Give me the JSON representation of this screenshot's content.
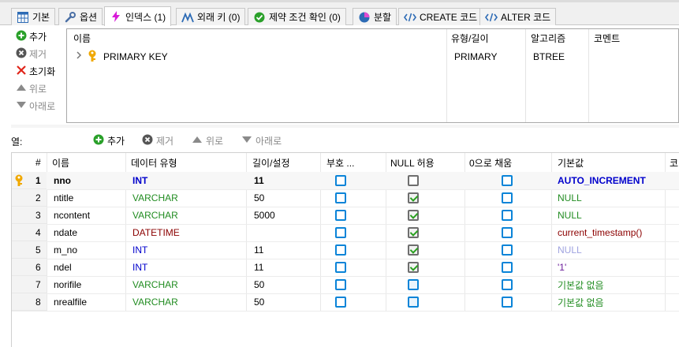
{
  "tabs": [
    {
      "label": "기본",
      "icon": "table-icon"
    },
    {
      "label": "옵션",
      "icon": "wrench-icon"
    },
    {
      "label": "인덱스 (1)",
      "icon": "lightning-icon"
    },
    {
      "label": "외래 키 (0)",
      "icon": "foreign-key-icon"
    },
    {
      "label": "제약 조건 확인 (0)",
      "icon": "check-circle-icon"
    },
    {
      "label": "분할",
      "icon": "pie-icon"
    },
    {
      "label": "CREATE 코드",
      "icon": "code-icon"
    },
    {
      "label": "ALTER 코드",
      "icon": "code-icon"
    }
  ],
  "index_toolbar": {
    "add": "추가",
    "remove": "제거",
    "reset": "초기화",
    "up": "위로",
    "down": "아래로"
  },
  "index_grid": {
    "headers": {
      "name": "이름",
      "type": "유형/길이",
      "algorithm": "알고리즘",
      "comment": "코멘트"
    },
    "rows": [
      {
        "name": "PRIMARY KEY",
        "type": "PRIMARY",
        "algorithm": "BTREE",
        "comment": ""
      }
    ]
  },
  "columns_toolbar": {
    "label": "열:",
    "add": "추가",
    "remove": "제거",
    "up": "위로",
    "down": "아래로"
  },
  "columns_grid": {
    "headers": {
      "num": "#",
      "name": "이름",
      "datatype": "데이터 유형",
      "length": "길이/설정",
      "unsigned": "부호 ...",
      "nullable": "NULL 허용",
      "zerofill": "0으로 채움",
      "default": "기본값",
      "comment": "코"
    },
    "rows": [
      {
        "num": "1",
        "name": "nno",
        "datatype": "INT",
        "length": "11",
        "unsigned": false,
        "nullable": false,
        "zerofill": false,
        "default": "AUTO_INCREMENT",
        "key": true
      },
      {
        "num": "2",
        "name": "ntitle",
        "datatype": "VARCHAR",
        "length": "50",
        "unsigned": false,
        "nullable": true,
        "zerofill": false,
        "default": "NULL"
      },
      {
        "num": "3",
        "name": "ncontent",
        "datatype": "VARCHAR",
        "length": "5000",
        "unsigned": false,
        "nullable": true,
        "zerofill": false,
        "default": "NULL"
      },
      {
        "num": "4",
        "name": "ndate",
        "datatype": "DATETIME",
        "length": "",
        "unsigned": false,
        "nullable": true,
        "zerofill": false,
        "default": "current_timestamp()"
      },
      {
        "num": "5",
        "name": "m_no",
        "datatype": "INT",
        "length": "11",
        "unsigned": false,
        "nullable": true,
        "zerofill": false,
        "default": "NULL"
      },
      {
        "num": "6",
        "name": "ndel",
        "datatype": "INT",
        "length": "11",
        "unsigned": false,
        "nullable": true,
        "zerofill": false,
        "default": "'1'"
      },
      {
        "num": "7",
        "name": "norifile",
        "datatype": "VARCHAR",
        "length": "50",
        "unsigned": false,
        "nullable": false,
        "zerofill": false,
        "default": "기본값 없음"
      },
      {
        "num": "8",
        "name": "nrealfile",
        "datatype": "VARCHAR",
        "length": "50",
        "unsigned": false,
        "nullable": false,
        "zerofill": false,
        "default": "기본값 없음"
      }
    ]
  },
  "colors": {
    "accent": "#0a84d8",
    "int": "#0000cc",
    "varchar": "#218c21",
    "datetime": "#8b0000",
    "key": "#f0a800"
  }
}
